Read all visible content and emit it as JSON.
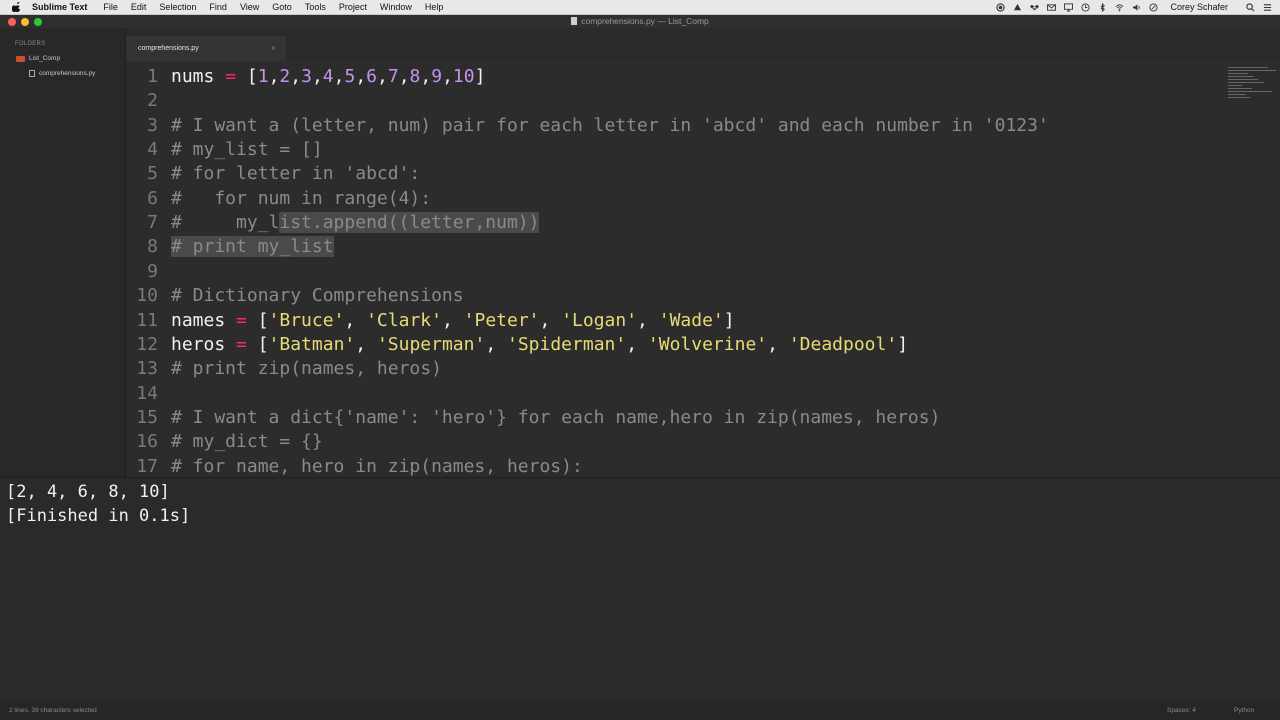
{
  "menubar": {
    "app": "Sublime Text",
    "items": [
      "File",
      "Edit",
      "Selection",
      "Find",
      "View",
      "Goto",
      "Tools",
      "Project",
      "Window",
      "Help"
    ],
    "user": "Corey Schafer",
    "status_icons": [
      "record-icon",
      "drive-icon",
      "dropbox-icon",
      "mail-icon",
      "airplay-icon",
      "time-machine-icon",
      "bluetooth-icon",
      "wifi-icon",
      "volume-icon",
      "battery-icon",
      "search-icon"
    ]
  },
  "window": {
    "title": "comprehensions.py — List_Comp"
  },
  "sidebar": {
    "header": "FOLDERS",
    "folder": "List_Comp",
    "file": "comprehensions.py"
  },
  "tab": {
    "label": "comprehensions.py",
    "close": "×"
  },
  "editor": {
    "lines": [
      {
        "n": "1",
        "tokens": [
          [
            "nums",
            "w"
          ],
          [
            " = ",
            "o"
          ],
          [
            "[",
            "w"
          ],
          [
            "1",
            "n"
          ],
          [
            ",",
            "w"
          ],
          [
            "2",
            "n"
          ],
          [
            ",",
            "w"
          ],
          [
            "3",
            "n"
          ],
          [
            ",",
            "w"
          ],
          [
            "4",
            "n"
          ],
          [
            ",",
            "w"
          ],
          [
            "5",
            "n"
          ],
          [
            ",",
            "w"
          ],
          [
            "6",
            "n"
          ],
          [
            ",",
            "w"
          ],
          [
            "7",
            "n"
          ],
          [
            ",",
            "w"
          ],
          [
            "8",
            "n"
          ],
          [
            ",",
            "w"
          ],
          [
            "9",
            "n"
          ],
          [
            ",",
            "w"
          ],
          [
            "10",
            "n"
          ],
          [
            "]",
            "w"
          ]
        ]
      },
      {
        "n": "2",
        "tokens": []
      },
      {
        "n": "3",
        "tokens": [
          [
            "# I want a (letter, num) pair for each letter in 'abcd' and each number in '0123'",
            "c"
          ]
        ]
      },
      {
        "n": "4",
        "tokens": [
          [
            "# my_list = []",
            "c"
          ]
        ]
      },
      {
        "n": "5",
        "tokens": [
          [
            "# for letter in 'abcd':",
            "c"
          ]
        ]
      },
      {
        "n": "6",
        "tokens": [
          [
            "#   for num in range(4):",
            "c"
          ]
        ]
      },
      {
        "n": "7",
        "tokens": [
          [
            "#     my_l",
            "c"
          ],
          [
            "ist.append((letter,num))",
            "cs"
          ]
        ]
      },
      {
        "n": "8",
        "tokens": [
          [
            "# print my_list",
            "cs"
          ]
        ]
      },
      {
        "n": "9",
        "tokens": []
      },
      {
        "n": "10",
        "tokens": [
          [
            "# Dictionary Comprehensions",
            "c"
          ]
        ]
      },
      {
        "n": "11",
        "tokens": [
          [
            "names",
            "w"
          ],
          [
            " = ",
            "o"
          ],
          [
            "[",
            "w"
          ],
          [
            "'Bruce'",
            "s"
          ],
          [
            ", ",
            "w"
          ],
          [
            "'Clark'",
            "s"
          ],
          [
            ", ",
            "w"
          ],
          [
            "'Peter'",
            "s"
          ],
          [
            ", ",
            "w"
          ],
          [
            "'Logan'",
            "s"
          ],
          [
            ", ",
            "w"
          ],
          [
            "'Wade'",
            "s"
          ],
          [
            "]",
            "w"
          ]
        ]
      },
      {
        "n": "12",
        "tokens": [
          [
            "heros",
            "w"
          ],
          [
            " = ",
            "o"
          ],
          [
            "[",
            "w"
          ],
          [
            "'Batman'",
            "s"
          ],
          [
            ", ",
            "w"
          ],
          [
            "'Superman'",
            "s"
          ],
          [
            ", ",
            "w"
          ],
          [
            "'Spiderman'",
            "s"
          ],
          [
            ", ",
            "w"
          ],
          [
            "'Wolverine'",
            "s"
          ],
          [
            ", ",
            "w"
          ],
          [
            "'Deadpool'",
            "s"
          ],
          [
            "]",
            "w"
          ]
        ]
      },
      {
        "n": "13",
        "tokens": [
          [
            "# print zip(names, heros)",
            "c"
          ]
        ]
      },
      {
        "n": "14",
        "tokens": []
      },
      {
        "n": "15",
        "tokens": [
          [
            "# I want a dict{'name': 'hero'} for each name,hero in zip(names, heros)",
            "c"
          ]
        ]
      },
      {
        "n": "16",
        "tokens": [
          [
            "# my_dict = {}",
            "c"
          ]
        ]
      },
      {
        "n": "17",
        "tokens": [
          [
            "# for name, hero in zip(names, heros):",
            "c"
          ]
        ]
      }
    ]
  },
  "output": {
    "lines": [
      "[2, 4, 6, 8, 10]",
      "[Finished in 0.1s]"
    ]
  },
  "statusbar": {
    "selection": "2 lines, 39 characters selected",
    "spaces": "Spaces: 4",
    "syntax": "Python"
  }
}
